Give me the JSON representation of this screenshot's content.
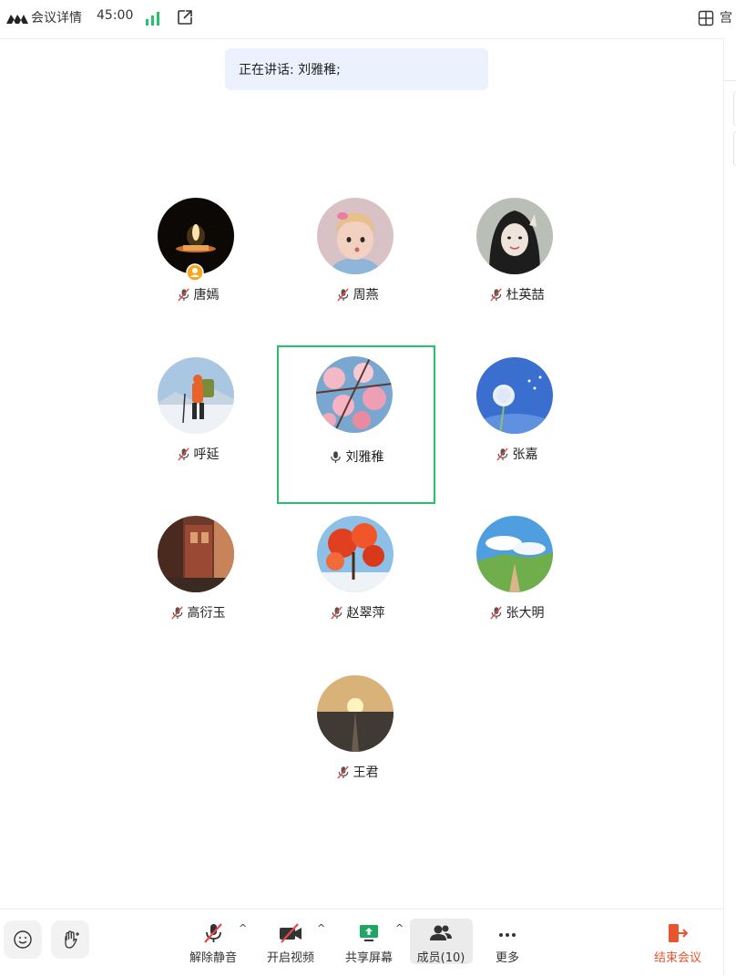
{
  "topbar": {
    "info_label": "会议详情",
    "timer": "45:00",
    "layout_label": "宫"
  },
  "speaking_banner": "正在讲话: 刘雅稚;",
  "participants": [
    {
      "name": "唐嫣",
      "muted": true,
      "host": true
    },
    {
      "name": "周燕",
      "muted": true
    },
    {
      "name": "杜英喆",
      "muted": true
    },
    {
      "name": "呼延",
      "muted": true
    },
    {
      "name": "刘雅稚",
      "muted": false,
      "speaking": true
    },
    {
      "name": "张嘉",
      "muted": true
    },
    {
      "name": "高衍玉",
      "muted": true
    },
    {
      "name": "赵翠萍",
      "muted": true
    },
    {
      "name": "张大明",
      "muted": true
    },
    {
      "name": "王君",
      "muted": true
    }
  ],
  "toolbar": {
    "unmute": "解除静音",
    "video": "开启视频",
    "share": "共享屏幕",
    "members": "成员(10)",
    "more": "更多",
    "end": "结束会议"
  },
  "colors": {
    "accent_green": "#24c26a",
    "banner_bg": "#ebf2fe",
    "end_red": "#e8542f",
    "muted_red": "#e84a4a"
  }
}
